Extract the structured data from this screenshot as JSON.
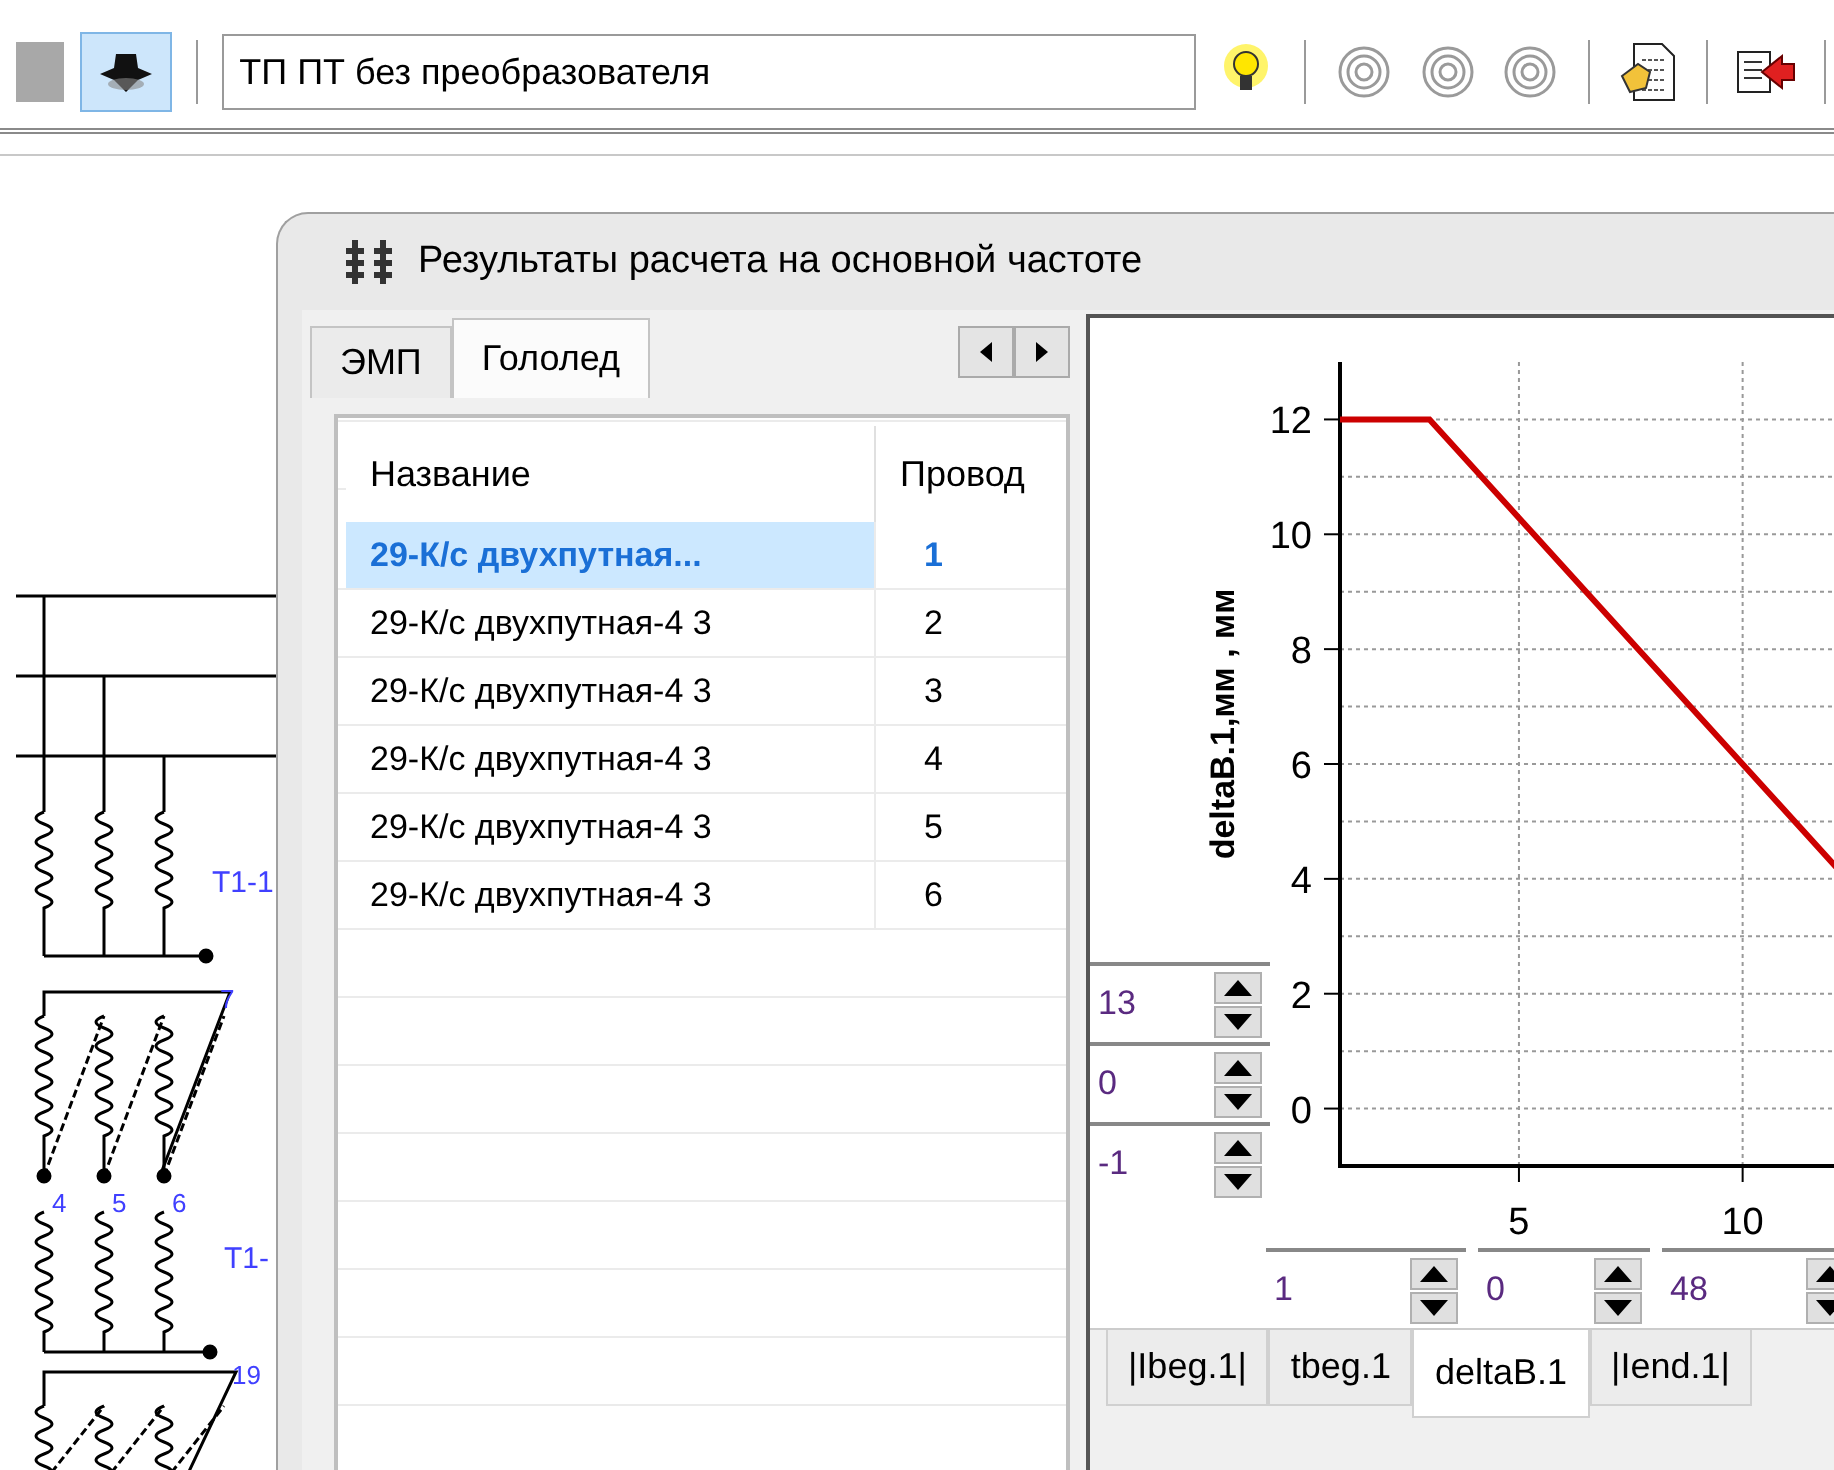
{
  "toolbar": {
    "view_button": {
      "selected": true
    },
    "scheme_field": {
      "value": "ТП ПТ без преобразователя"
    },
    "ring_buttons": [
      {
        "disabled": true
      },
      {
        "disabled": true
      },
      {
        "disabled": true
      }
    ]
  },
  "schematic": {
    "labels": [
      "T1-1",
      "7",
      "4",
      "5",
      "6",
      "T1-",
      "19"
    ]
  },
  "dialog": {
    "title": "Результаты расчета на основной частоте",
    "tabs": [
      {
        "label": "ЭМП",
        "selected": false
      },
      {
        "label": "Гололед",
        "selected": true
      }
    ],
    "table": {
      "columns": [
        "Название",
        "Провод"
      ],
      "rows": [
        {
          "cells": [
            "29-К/с двухпутная...",
            "1"
          ],
          "selected": true
        },
        {
          "cells": [
            "29-К/с двухпутная-4 3",
            "2"
          ],
          "selected": false
        },
        {
          "cells": [
            "29-К/с двухпутная-4 3",
            "3"
          ],
          "selected": false
        },
        {
          "cells": [
            "29-К/с двухпутная-4 3",
            "4"
          ],
          "selected": false
        },
        {
          "cells": [
            "29-К/с двухпутная-4 3",
            "5"
          ],
          "selected": false
        },
        {
          "cells": [
            "29-К/с двухпутная-4 3",
            "6"
          ],
          "selected": false
        }
      ]
    },
    "chart": {
      "chart_data": {
        "type": "line",
        "ylabel": "deltaB.1,мм , мм",
        "x": [
          1,
          3,
          12.33
        ],
        "series": [
          {
            "color": "#cc0000",
            "values": [
              12,
              12,
              4
            ]
          }
        ],
        "grid": true,
        "xlim": [
          1,
          12.4
        ],
        "ylim": [
          -1,
          13
        ],
        "xticks": [
          5,
          10
        ],
        "yticks": [
          0,
          2,
          4,
          6,
          8,
          10,
          12
        ]
      },
      "y_spinners": [
        "13",
        "0",
        "-1"
      ],
      "x_spinners": [
        "1",
        "0",
        "48"
      ],
      "tabs": [
        {
          "label": "|Ibeg.1|",
          "selected": false
        },
        {
          "label": "tbeg.1",
          "selected": false
        },
        {
          "label": "deltaB.1",
          "selected": true
        },
        {
          "label": "|Iend.1|",
          "selected": false
        }
      ]
    }
  }
}
